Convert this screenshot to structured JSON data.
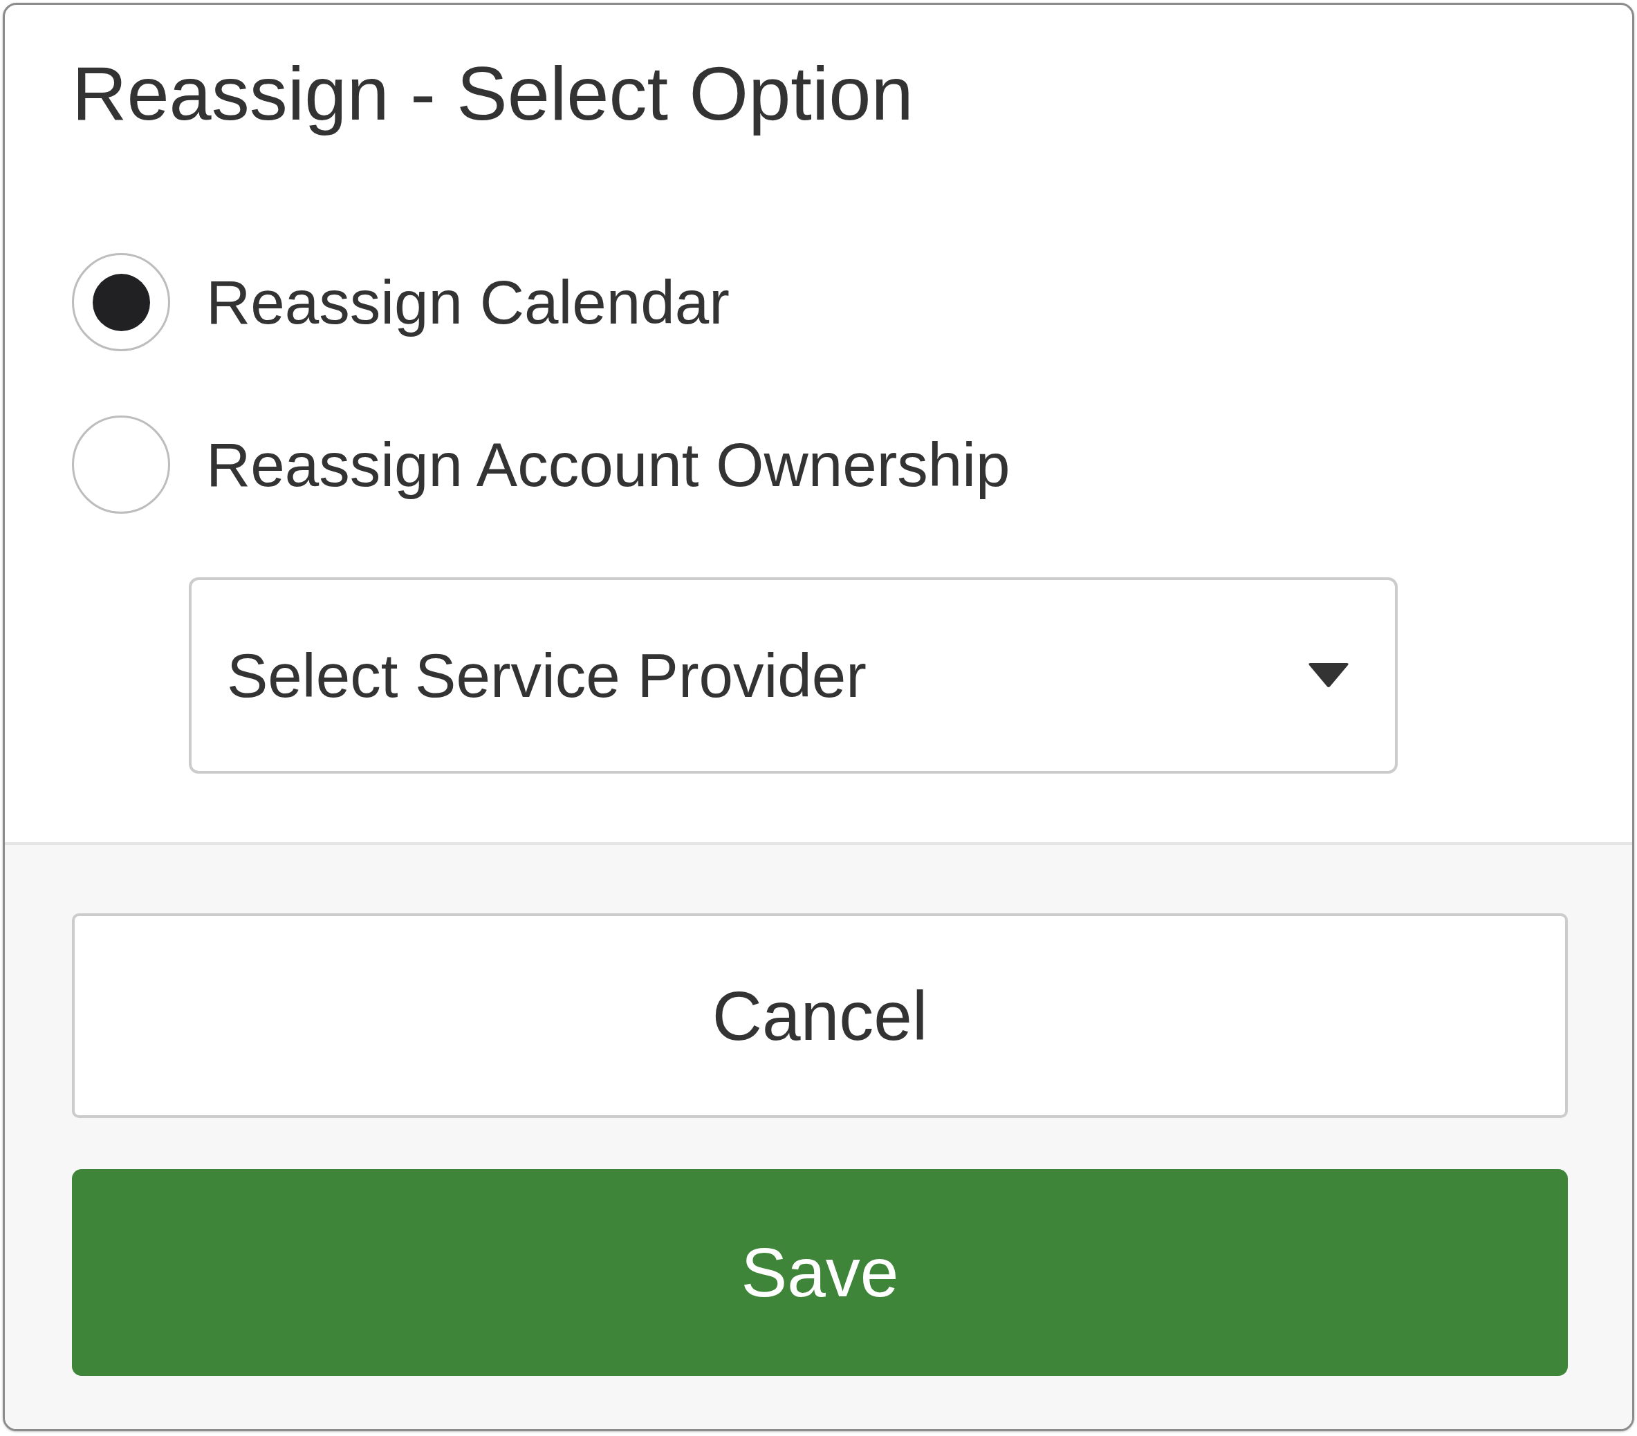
{
  "dialog": {
    "title": "Reassign - Select Option"
  },
  "options": [
    {
      "label": "Reassign Calendar",
      "selected": true
    },
    {
      "label": "Reassign Account Ownership",
      "selected": false
    }
  ],
  "service_provider": {
    "placeholder": "Select Service Provider"
  },
  "buttons": [
    {
      "label": "Cancel",
      "kind": "secondary"
    },
    {
      "label": "Save",
      "kind": "primary"
    }
  ]
}
